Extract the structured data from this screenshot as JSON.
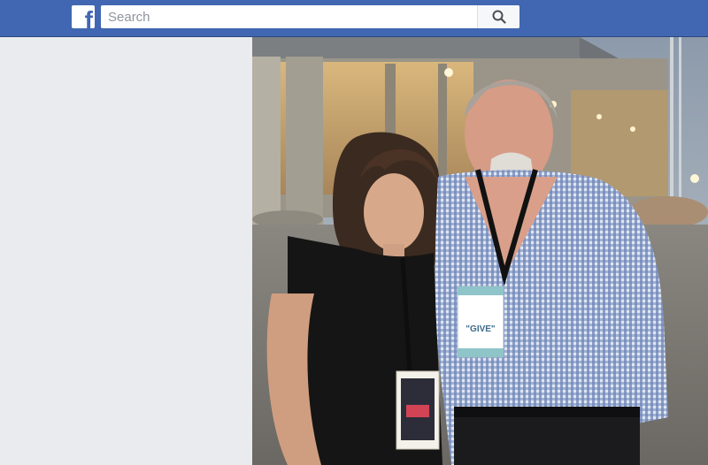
{
  "header": {
    "logo_letter": "f",
    "logo_icon": "facebook-logo-icon",
    "search": {
      "placeholder": "Search",
      "value": "",
      "button_icon": "search-icon"
    }
  },
  "colors": {
    "topbar": "#4267b2",
    "page_background": "#e9ebee",
    "search_button": "#f6f7f9"
  },
  "photo": {
    "lanyard_badge_text": "\"GIVE\""
  }
}
